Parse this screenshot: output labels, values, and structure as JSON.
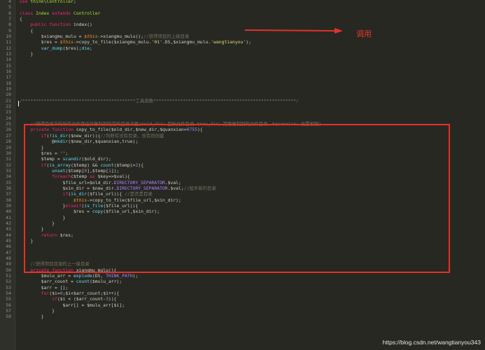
{
  "colors": {
    "background": "#272822",
    "annotation": "#e0332b",
    "keyword": "#f92672",
    "function": "#66d9ef",
    "string": "#e6db74",
    "comment": "#75715e"
  },
  "annotation": {
    "label": "调用",
    "icon": "arrow-right-icon"
  },
  "watermark": "https://blog.csdn.net/wangtianyou343",
  "editor": {
    "lines": [
      {
        "n": "4",
        "code": "use think\\Controller;"
      },
      {
        "n": "5",
        "code": ""
      },
      {
        "n": "6",
        "code": "class Index extends Controller"
      },
      {
        "n": "7",
        "code": "{"
      },
      {
        "n": "8",
        "code": "    public function index()"
      },
      {
        "n": "9",
        "code": "    {"
      },
      {
        "n": "10",
        "code": "        $xiangmu_mulu = $this->xiangmu_mulu();//获得项目的上级目录"
      },
      {
        "n": "11",
        "code": "        $res = $this->copy_to_file($xiangmu_mulu.'01'.DS,$xiangmu_mulu.'wangtianyou');"
      },
      {
        "n": "12",
        "code": "        var_dump($res);die;"
      },
      {
        "n": "13",
        "code": "    }"
      },
      {
        "n": "14",
        "code": ""
      },
      {
        "n": "15",
        "code": ""
      },
      {
        "n": "16",
        "code": ""
      },
      {
        "n": "17",
        "code": ""
      },
      {
        "n": "18",
        "code": ""
      },
      {
        "n": "19",
        "code": ""
      },
      {
        "n": "20",
        "code": ""
      },
      {
        "n": "21",
        "code": "/******************************************工具函数*****************************************************/"
      },
      {
        "n": "22",
        "code": ""
      },
      {
        "n": "23",
        "code": ""
      },
      {
        "n": "24",
        "code": ""
      },
      {
        "n": "25",
        "code": "    //获得目录下的所有文件路径并复制到指定的目录下面($old_dir：目标文件目录 $new_dir：需要复制到的文件目录，$quanxian：设置权限)"
      },
      {
        "n": "26",
        "code": "    private function copy_to_file($old_dir,$new_dir,$quanxian=0755){"
      },
      {
        "n": "27",
        "code": "        if(!is_dir($new_dir)){//判断有没有目录，没有则创建"
      },
      {
        "n": "28",
        "code": "            @mkdir($new_dir,$quanxian,true);"
      },
      {
        "n": "29",
        "code": "        }"
      },
      {
        "n": "30",
        "code": "        $res = '';"
      },
      {
        "n": "31",
        "code": "        $temp = scandir($old_dir);"
      },
      {
        "n": "32",
        "code": "        if(is_array($temp) && count($temp)>2){"
      },
      {
        "n": "33",
        "code": "            unset($temp[0],$temp[1]);"
      },
      {
        "n": "34",
        "code": "            foreach($temp as $key=>$val){"
      },
      {
        "n": "35",
        "code": "                $file_url=$old_dir.DIRECTORY_SEPARATOR.$val;"
      },
      {
        "n": "36",
        "code": "                $xin_dir = $new_dir.DIRECTORY_SEPARATOR.$val;//组件新的目录"
      },
      {
        "n": "37",
        "code": "                if(is_dir($file_url)){ //是否是目录"
      },
      {
        "n": "38",
        "code": "                    $this->copy_to_file($file_url,$xin_dir);"
      },
      {
        "n": "39",
        "code": "                }elseif(is_file($file_url)){"
      },
      {
        "n": "40",
        "code": "                    $res = copy($file_url,$xin_dir);"
      },
      {
        "n": "41",
        "code": "                }"
      },
      {
        "n": "42",
        "code": "            }"
      },
      {
        "n": "43",
        "code": "        }"
      },
      {
        "n": "44",
        "code": "        return $res;"
      },
      {
        "n": "45",
        "code": "    }"
      },
      {
        "n": "46",
        "code": ""
      },
      {
        "n": "47",
        "code": ""
      },
      {
        "n": "48",
        "code": ""
      },
      {
        "n": "49",
        "code": "    //获得项目目录的上一级目录"
      },
      {
        "n": "50",
        "code": "    private function xiangmu_mulu(){"
      },
      {
        "n": "51",
        "code": "        $mulu_arr = explode(DS, THINK_PATH);"
      },
      {
        "n": "52",
        "code": "        $arr_count = count($mulu_arr);"
      },
      {
        "n": "53",
        "code": "        $arr = [];"
      },
      {
        "n": "54",
        "code": "        for($i=0;$i<$arr_count;$i++){"
      },
      {
        "n": "55",
        "code": "            if($i < ($arr_count-3)){"
      },
      {
        "n": "56",
        "code": "                $arr[] = $mulu_arr[$i];"
      },
      {
        "n": "57",
        "code": "            }"
      },
      {
        "n": "58",
        "code": "        }"
      }
    ]
  }
}
